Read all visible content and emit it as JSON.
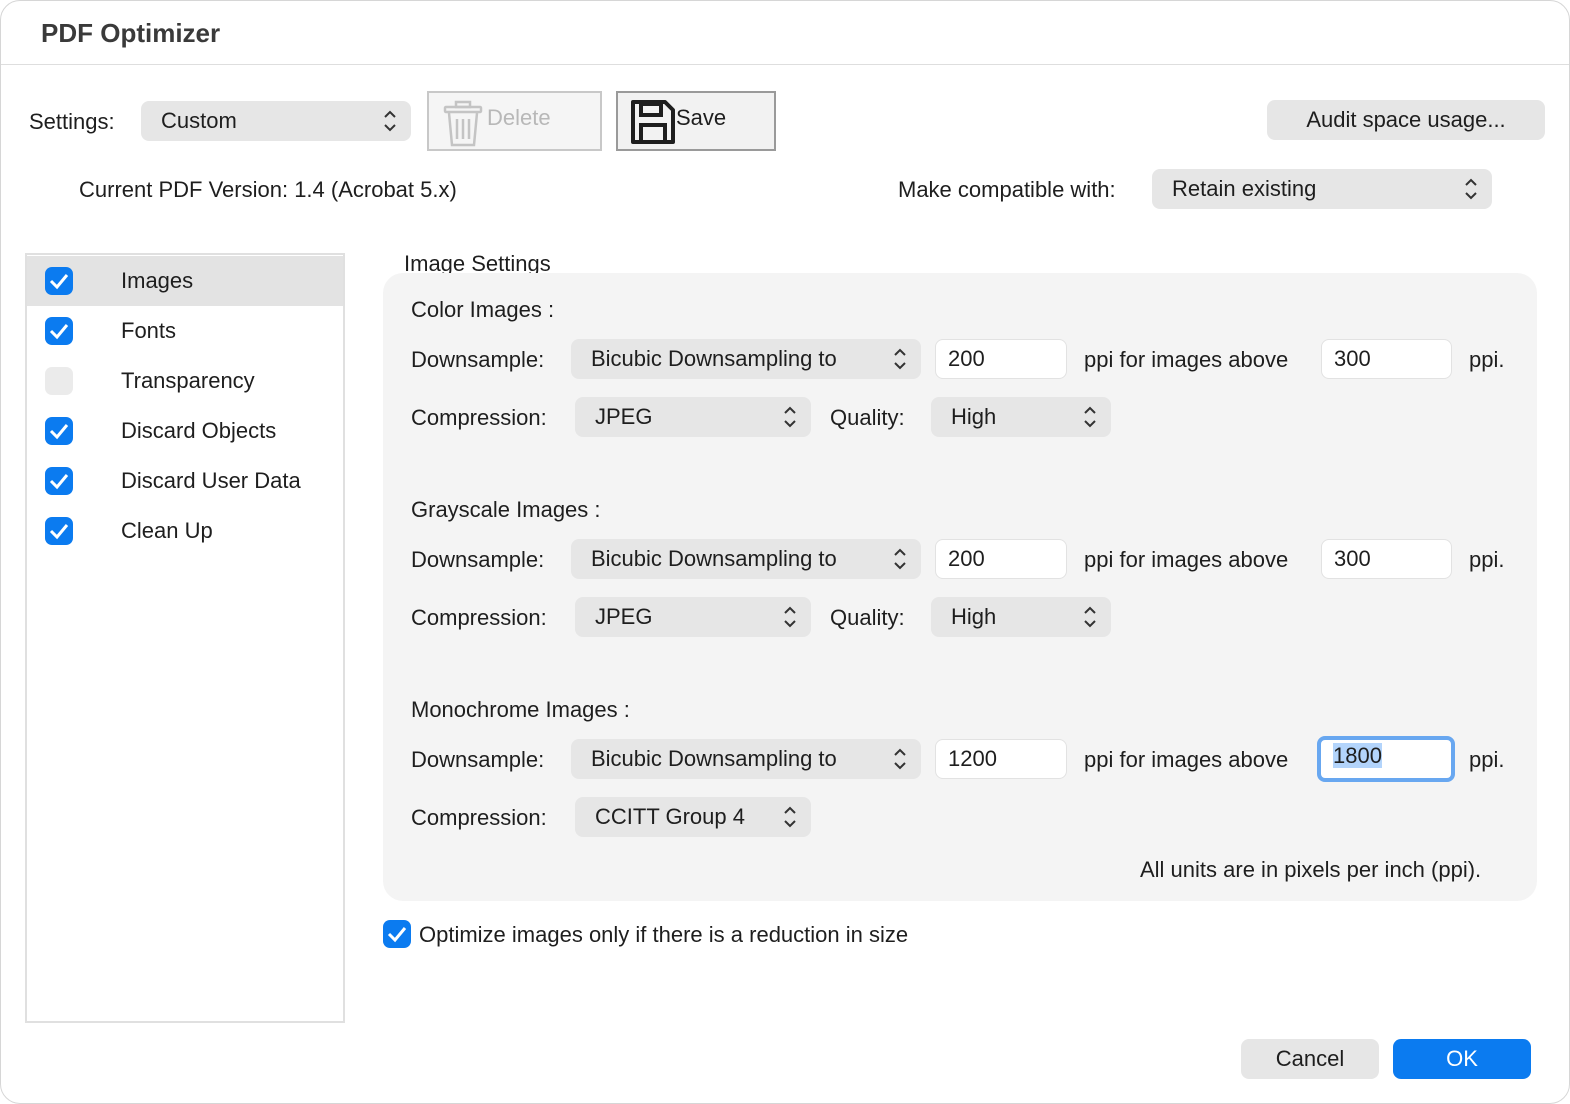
{
  "window": {
    "title": "PDF Optimizer"
  },
  "toolbar": {
    "settings_label": "Settings:",
    "settings_value": "Custom",
    "delete_label": "Delete",
    "save_label": "Save",
    "audit_label": "Audit space usage..."
  },
  "version": {
    "current": "Current PDF Version: 1.4 (Acrobat 5.x)",
    "compat_label": "Make compatible with:",
    "compat_value": "Retain existing"
  },
  "sidebar": {
    "items": [
      {
        "label": "Images",
        "checked": true,
        "selected": true
      },
      {
        "label": "Fonts",
        "checked": true
      },
      {
        "label": "Transparency",
        "checked": false
      },
      {
        "label": "Discard Objects",
        "checked": true
      },
      {
        "label": "Discard User Data",
        "checked": true
      },
      {
        "label": "Clean Up",
        "checked": true
      }
    ]
  },
  "image_settings": {
    "title": "Image Settings",
    "downsample_label": "Downsample:",
    "compression_label": "Compression:",
    "quality_label": "Quality:",
    "ppi_above_label": "ppi for images above",
    "ppi_suffix": "ppi.",
    "color": {
      "heading": "Color Images :",
      "method": "Bicubic Downsampling to",
      "ppi": "200",
      "above": "300",
      "compression": "JPEG",
      "quality": "High"
    },
    "grayscale": {
      "heading": "Grayscale Images :",
      "method": "Bicubic Downsampling to",
      "ppi": "200",
      "above": "300",
      "compression": "JPEG",
      "quality": "High"
    },
    "monochrome": {
      "heading": "Monochrome Images :",
      "method": "Bicubic Downsampling to",
      "ppi": "1200",
      "above": "1800",
      "compression": "CCITT Group 4"
    },
    "units_note": "All units are in pixels per inch (ppi)."
  },
  "optimize_only": {
    "label": "Optimize images only if there is a reduction in size",
    "checked": true
  },
  "footer": {
    "cancel_label": "Cancel",
    "ok_label": "OK"
  },
  "colors": {
    "accent": "#0b7bf0",
    "focus_ring": "#68a7f0",
    "panel_bg": "#f4f4f4"
  }
}
